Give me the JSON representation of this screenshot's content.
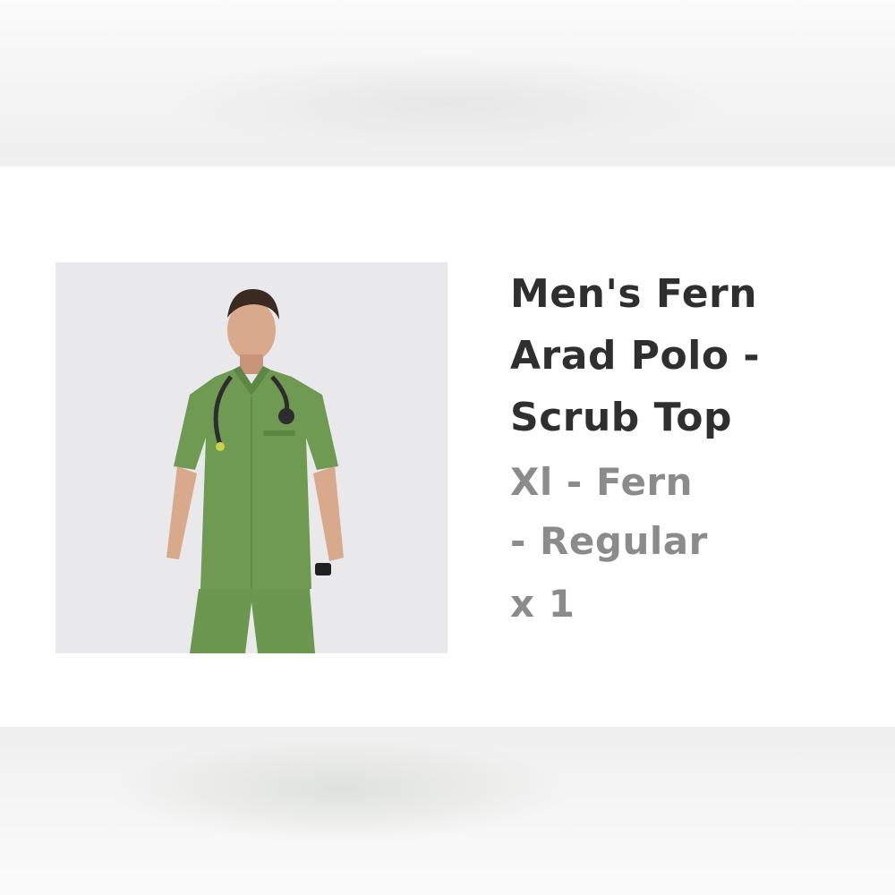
{
  "product": {
    "title_lines": [
      "Men's Fern",
      "Arad Polo -",
      "Scrub Top"
    ],
    "variant_lines": [
      "Xl - Fern",
      "- Regular"
    ],
    "quantity": "x 1",
    "image": "product-photo",
    "colors": {
      "title": "#2f2f2f",
      "variant": "#8b8b8b",
      "garment": "#6e9a52",
      "image_background": "#e8e8ea"
    }
  }
}
